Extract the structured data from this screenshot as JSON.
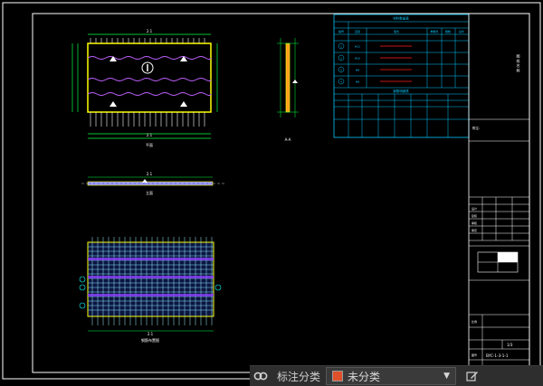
{
  "drawing": {
    "top_plan": {
      "dim_top": "2.1",
      "dim_bottom": "2.1",
      "caption": "平面"
    },
    "side_section": {
      "caption": "A-A"
    },
    "elevation": {
      "dim_top": "2.1",
      "caption": "立面"
    },
    "rebar_plan": {
      "dim_bottom": "2.1",
      "caption": "钢筋布置图"
    },
    "table": {
      "title": "材料数量表",
      "subtitle": "钢筋明细表",
      "headers": [
        "编号",
        "直径",
        "型式",
        "单根长",
        "根数",
        "总长",
        "重量"
      ],
      "rows": [
        {
          "id": "1",
          "dia": "Φ12"
        },
        {
          "id": "2",
          "dia": "Φ10"
        },
        {
          "id": "3",
          "dia": "Φ8"
        },
        {
          "id": "4",
          "dia": "Φ8"
        }
      ]
    },
    "notes": {
      "label": "附注:"
    },
    "title_block": {
      "side_text": "图 纸 名 称",
      "row_labels": [
        "设计",
        "复核",
        "审核",
        "审定"
      ],
      "scale_label": "比例",
      "drawing_no_label": "图号",
      "page": "1/3",
      "drawing_no": "BYC-1-3-1-1"
    }
  },
  "bottom_bar": {
    "menu_icon": "link-icon",
    "annotate_label": "标注分类",
    "category_value": "未分类",
    "category_color": "#e0502a",
    "edit_icon": "edit-icon"
  }
}
